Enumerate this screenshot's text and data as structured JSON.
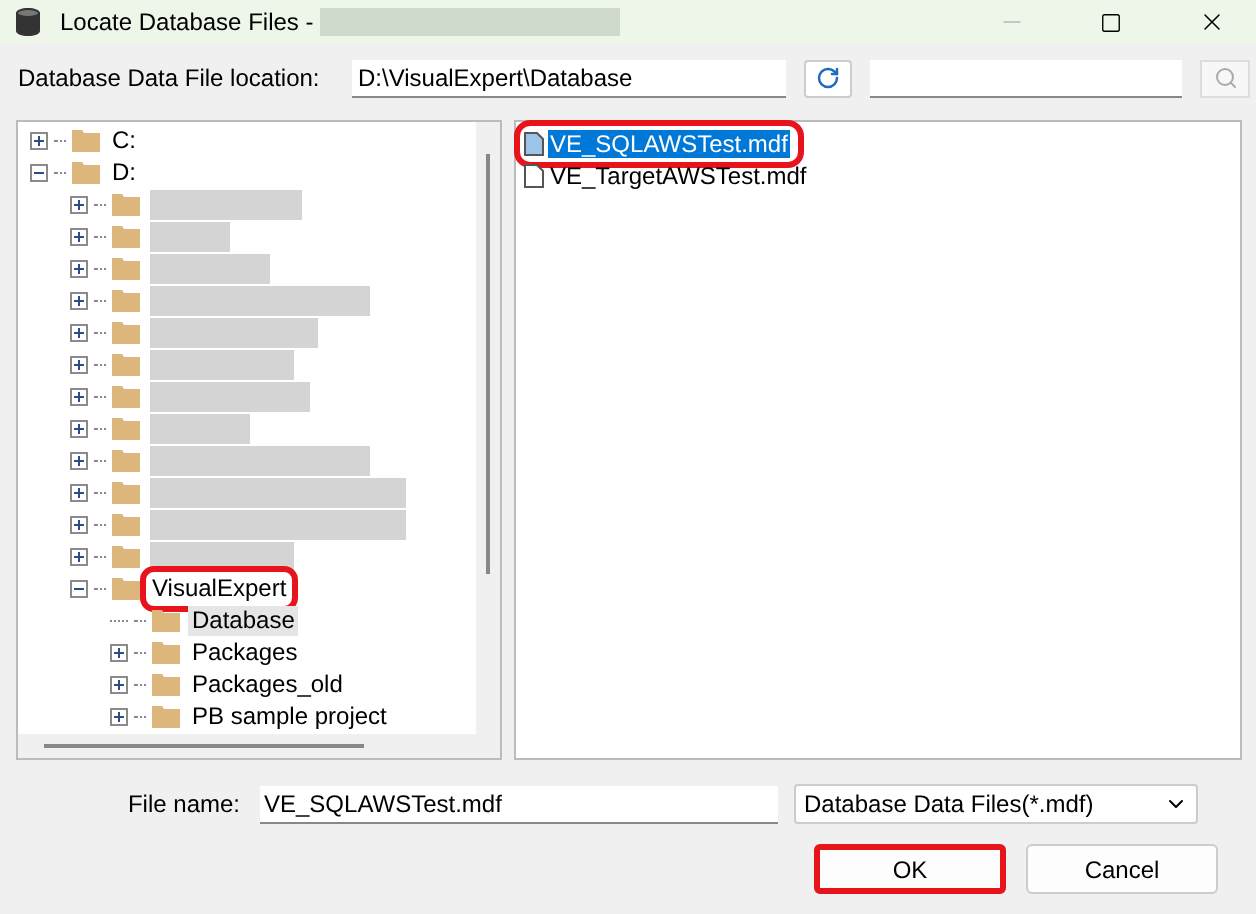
{
  "window": {
    "title": "Locate Database Files -",
    "title_redacted": true
  },
  "location": {
    "label": "Database Data File location:",
    "value": "D:\\VisualExpert\\Database"
  },
  "tree": [
    {
      "label": "C:",
      "expanded": false,
      "highlighted": false,
      "selected": false
    },
    {
      "label": "D:",
      "expanded": true,
      "highlighted": false,
      "selected": false,
      "children": [
        {
          "kind": "redacted",
          "expanded": false
        },
        {
          "kind": "redacted",
          "expanded": false
        },
        {
          "kind": "redacted",
          "expanded": false
        },
        {
          "kind": "redacted",
          "expanded": false
        },
        {
          "kind": "redacted",
          "expanded": false
        },
        {
          "kind": "redacted",
          "expanded": false
        },
        {
          "kind": "redacted",
          "expanded": false
        },
        {
          "kind": "redacted",
          "expanded": false
        },
        {
          "kind": "redacted",
          "expanded": false
        },
        {
          "kind": "redacted",
          "expanded": false
        },
        {
          "kind": "redacted",
          "expanded": false
        },
        {
          "kind": "redacted",
          "expanded": false
        },
        {
          "label": "VisualExpert",
          "expanded": true,
          "highlighted": true,
          "selected": false,
          "children": [
            {
              "label": "Database",
              "leaf": true,
              "highlighted": false,
              "selected": true
            },
            {
              "label": "Packages",
              "expanded": false,
              "highlighted": false,
              "selected": false
            },
            {
              "label": "Packages_old",
              "expanded": false,
              "highlighted": false,
              "selected": false
            },
            {
              "label": "PB sample project",
              "expanded": false,
              "highlighted": false,
              "selected": false
            }
          ]
        }
      ]
    }
  ],
  "files": [
    {
      "name": "VE_SQLAWSTest.mdf",
      "selected": true,
      "highlighted": true
    },
    {
      "name": "VE_TargetAWSTest.mdf",
      "selected": false,
      "highlighted": false
    }
  ],
  "file_name": {
    "label": "File name:",
    "value": "VE_SQLAWSTest.mdf"
  },
  "file_type": {
    "value": "Database Data Files(*.mdf)"
  },
  "buttons": [
    {
      "label": "OK",
      "highlighted": true
    },
    {
      "label": "Cancel",
      "highlighted": false
    }
  ]
}
